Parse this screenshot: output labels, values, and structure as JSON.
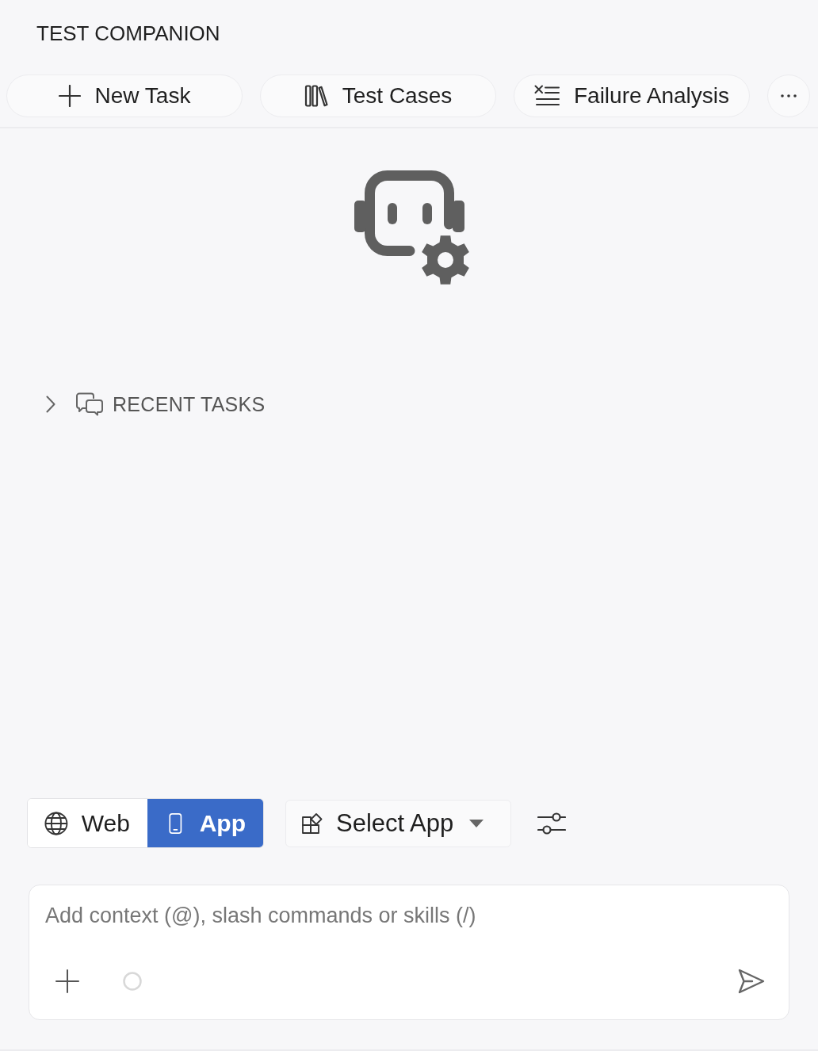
{
  "header": {
    "title": "TEST COMPANION"
  },
  "actions": [
    {
      "label": "New Task"
    },
    {
      "label": "Test Cases"
    },
    {
      "label": "Failure Analysis"
    }
  ],
  "recent_tasks": {
    "label": "RECENT TASKS",
    "expanded": false
  },
  "mode_toggle": [
    {
      "label": "Web",
      "selected": false
    },
    {
      "label": "App",
      "selected": true
    }
  ],
  "app_select": {
    "label": "Select App"
  },
  "composer": {
    "placeholder": "Add context (@), slash commands or skills (/)"
  }
}
